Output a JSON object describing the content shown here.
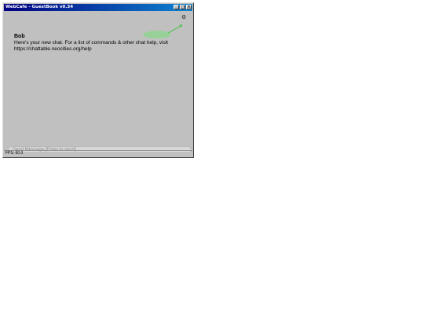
{
  "window": {
    "title": "WebCafe - GuestBook v0.34",
    "controls": [
      "_",
      "□",
      "×"
    ]
  },
  "chat": {
    "settings_icon": "gear-icon",
    "messages": [
      {
        "user": "Bob",
        "text": "Here's your new chat. For a list of commands & other chat help, visit https://chattable.neocities.org/help"
      }
    ]
  },
  "input": {
    "placeholder": "Send Message [Enter to send]"
  },
  "status": {
    "fps": "FPS: 60.0"
  }
}
